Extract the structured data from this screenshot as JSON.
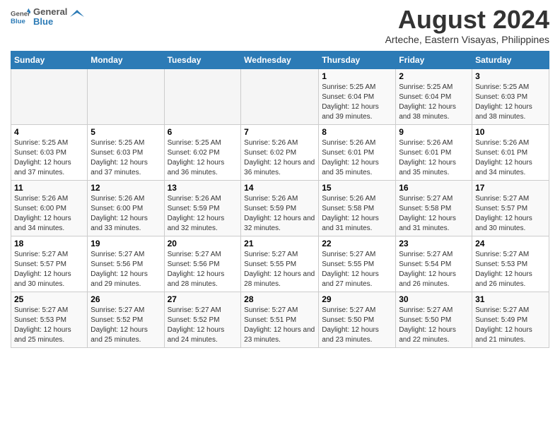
{
  "header": {
    "logo_line1": "General",
    "logo_line2": "Blue",
    "title": "August 2024",
    "subtitle": "Arteche, Eastern Visayas, Philippines"
  },
  "weekdays": [
    "Sunday",
    "Monday",
    "Tuesday",
    "Wednesday",
    "Thursday",
    "Friday",
    "Saturday"
  ],
  "weeks": [
    [
      {
        "day": "",
        "empty": true
      },
      {
        "day": "",
        "empty": true
      },
      {
        "day": "",
        "empty": true
      },
      {
        "day": "",
        "empty": true
      },
      {
        "day": "1",
        "sunrise": "5:25 AM",
        "sunset": "6:04 PM",
        "daylight": "12 hours and 39 minutes."
      },
      {
        "day": "2",
        "sunrise": "5:25 AM",
        "sunset": "6:04 PM",
        "daylight": "12 hours and 38 minutes."
      },
      {
        "day": "3",
        "sunrise": "5:25 AM",
        "sunset": "6:03 PM",
        "daylight": "12 hours and 38 minutes."
      }
    ],
    [
      {
        "day": "4",
        "sunrise": "5:25 AM",
        "sunset": "6:03 PM",
        "daylight": "12 hours and 37 minutes."
      },
      {
        "day": "5",
        "sunrise": "5:25 AM",
        "sunset": "6:03 PM",
        "daylight": "12 hours and 37 minutes."
      },
      {
        "day": "6",
        "sunrise": "5:25 AM",
        "sunset": "6:02 PM",
        "daylight": "12 hours and 36 minutes."
      },
      {
        "day": "7",
        "sunrise": "5:26 AM",
        "sunset": "6:02 PM",
        "daylight": "12 hours and 36 minutes."
      },
      {
        "day": "8",
        "sunrise": "5:26 AM",
        "sunset": "6:01 PM",
        "daylight": "12 hours and 35 minutes."
      },
      {
        "day": "9",
        "sunrise": "5:26 AM",
        "sunset": "6:01 PM",
        "daylight": "12 hours and 35 minutes."
      },
      {
        "day": "10",
        "sunrise": "5:26 AM",
        "sunset": "6:01 PM",
        "daylight": "12 hours and 34 minutes."
      }
    ],
    [
      {
        "day": "11",
        "sunrise": "5:26 AM",
        "sunset": "6:00 PM",
        "daylight": "12 hours and 34 minutes."
      },
      {
        "day": "12",
        "sunrise": "5:26 AM",
        "sunset": "6:00 PM",
        "daylight": "12 hours and 33 minutes."
      },
      {
        "day": "13",
        "sunrise": "5:26 AM",
        "sunset": "5:59 PM",
        "daylight": "12 hours and 32 minutes."
      },
      {
        "day": "14",
        "sunrise": "5:26 AM",
        "sunset": "5:59 PM",
        "daylight": "12 hours and 32 minutes."
      },
      {
        "day": "15",
        "sunrise": "5:26 AM",
        "sunset": "5:58 PM",
        "daylight": "12 hours and 31 minutes."
      },
      {
        "day": "16",
        "sunrise": "5:27 AM",
        "sunset": "5:58 PM",
        "daylight": "12 hours and 31 minutes."
      },
      {
        "day": "17",
        "sunrise": "5:27 AM",
        "sunset": "5:57 PM",
        "daylight": "12 hours and 30 minutes."
      }
    ],
    [
      {
        "day": "18",
        "sunrise": "5:27 AM",
        "sunset": "5:57 PM",
        "daylight": "12 hours and 30 minutes."
      },
      {
        "day": "19",
        "sunrise": "5:27 AM",
        "sunset": "5:56 PM",
        "daylight": "12 hours and 29 minutes."
      },
      {
        "day": "20",
        "sunrise": "5:27 AM",
        "sunset": "5:56 PM",
        "daylight": "12 hours and 28 minutes."
      },
      {
        "day": "21",
        "sunrise": "5:27 AM",
        "sunset": "5:55 PM",
        "daylight": "12 hours and 28 minutes."
      },
      {
        "day": "22",
        "sunrise": "5:27 AM",
        "sunset": "5:55 PM",
        "daylight": "12 hours and 27 minutes."
      },
      {
        "day": "23",
        "sunrise": "5:27 AM",
        "sunset": "5:54 PM",
        "daylight": "12 hours and 26 minutes."
      },
      {
        "day": "24",
        "sunrise": "5:27 AM",
        "sunset": "5:53 PM",
        "daylight": "12 hours and 26 minutes."
      }
    ],
    [
      {
        "day": "25",
        "sunrise": "5:27 AM",
        "sunset": "5:53 PM",
        "daylight": "12 hours and 25 minutes."
      },
      {
        "day": "26",
        "sunrise": "5:27 AM",
        "sunset": "5:52 PM",
        "daylight": "12 hours and 25 minutes."
      },
      {
        "day": "27",
        "sunrise": "5:27 AM",
        "sunset": "5:52 PM",
        "daylight": "12 hours and 24 minutes."
      },
      {
        "day": "28",
        "sunrise": "5:27 AM",
        "sunset": "5:51 PM",
        "daylight": "12 hours and 23 minutes."
      },
      {
        "day": "29",
        "sunrise": "5:27 AM",
        "sunset": "5:50 PM",
        "daylight": "12 hours and 23 minutes."
      },
      {
        "day": "30",
        "sunrise": "5:27 AM",
        "sunset": "5:50 PM",
        "daylight": "12 hours and 22 minutes."
      },
      {
        "day": "31",
        "sunrise": "5:27 AM",
        "sunset": "5:49 PM",
        "daylight": "12 hours and 21 minutes."
      }
    ]
  ],
  "labels": {
    "sunrise": "Sunrise:",
    "sunset": "Sunset:",
    "daylight": "Daylight:"
  }
}
